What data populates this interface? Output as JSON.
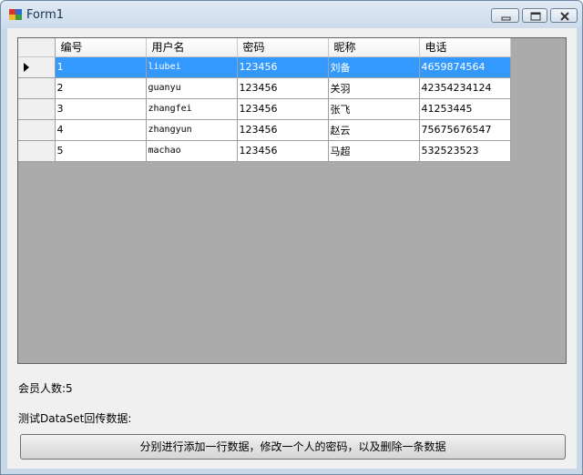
{
  "window": {
    "title": "Form1"
  },
  "grid": {
    "columns": [
      "编号",
      "用户名",
      "密码",
      "昵称",
      "电话"
    ],
    "rows": [
      {
        "id": "1",
        "username": "liubei",
        "password": "123456",
        "nickname": "刘备",
        "phone": "4659874564",
        "selected": true
      },
      {
        "id": "2",
        "username": "guanyu",
        "password": "123456",
        "nickname": "关羽",
        "phone": "42354234124",
        "selected": false
      },
      {
        "id": "3",
        "username": "zhangfei",
        "password": "123456",
        "nickname": "张飞",
        "phone": "41253445",
        "selected": false
      },
      {
        "id": "4",
        "username": "zhangyun",
        "password": "123456",
        "nickname": "赵云",
        "phone": "75675676547",
        "selected": false
      },
      {
        "id": "5",
        "username": "machao",
        "password": "123456",
        "nickname": "马超",
        "phone": "532523523",
        "selected": false
      }
    ],
    "selection_color": "#3399ff",
    "background_color": "#ababab"
  },
  "labels": {
    "member_count": "会员人数:5",
    "test_dataset": "测试DataSet回传数据:"
  },
  "action_button": {
    "label": "分别进行添加一行数据，修改一个人的密码，以及删除一条数据"
  },
  "icons": {
    "app": "form-app-icon",
    "minimize": "minimize-icon",
    "maximize": "maximize-icon",
    "close": "close-icon",
    "row_indicator": "row-pointer-icon"
  }
}
